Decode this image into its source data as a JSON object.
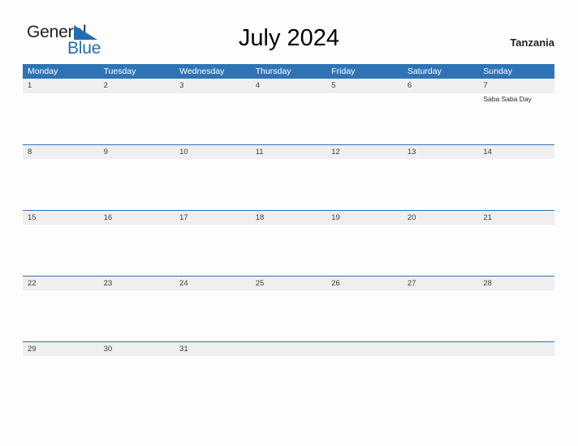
{
  "brand": {
    "name_part1": "General",
    "name_part2": "Blue",
    "flag_icon": "blue-triangle-flag-icon",
    "color_dark": "#231f20",
    "color_blue": "#1f6eb3"
  },
  "header": {
    "title": "July 2024",
    "country": "Tanzania"
  },
  "theme": {
    "accent": "#2e74b5",
    "date_band": "#efefef",
    "page_background": "#fdfdfd",
    "header_text": "#ffffff"
  },
  "calendar": {
    "month": "July",
    "year": "2024",
    "week_start": "Monday",
    "weekdays": [
      "Monday",
      "Tuesday",
      "Wednesday",
      "Thursday",
      "Friday",
      "Saturday",
      "Sunday"
    ],
    "weeks": [
      {
        "days": [
          {
            "date": "1",
            "events": []
          },
          {
            "date": "2",
            "events": []
          },
          {
            "date": "3",
            "events": []
          },
          {
            "date": "4",
            "events": []
          },
          {
            "date": "5",
            "events": []
          },
          {
            "date": "6",
            "events": []
          },
          {
            "date": "7",
            "events": [
              "Saba Saba Day"
            ]
          }
        ]
      },
      {
        "days": [
          {
            "date": "8",
            "events": []
          },
          {
            "date": "9",
            "events": []
          },
          {
            "date": "10",
            "events": []
          },
          {
            "date": "11",
            "events": []
          },
          {
            "date": "12",
            "events": []
          },
          {
            "date": "13",
            "events": []
          },
          {
            "date": "14",
            "events": []
          }
        ]
      },
      {
        "days": [
          {
            "date": "15",
            "events": []
          },
          {
            "date": "16",
            "events": []
          },
          {
            "date": "17",
            "events": []
          },
          {
            "date": "18",
            "events": []
          },
          {
            "date": "19",
            "events": []
          },
          {
            "date": "20",
            "events": []
          },
          {
            "date": "21",
            "events": []
          }
        ]
      },
      {
        "days": [
          {
            "date": "22",
            "events": []
          },
          {
            "date": "23",
            "events": []
          },
          {
            "date": "24",
            "events": []
          },
          {
            "date": "25",
            "events": []
          },
          {
            "date": "26",
            "events": []
          },
          {
            "date": "27",
            "events": []
          },
          {
            "date": "28",
            "events": []
          }
        ]
      },
      {
        "days": [
          {
            "date": "29",
            "events": []
          },
          {
            "date": "30",
            "events": []
          },
          {
            "date": "31",
            "events": []
          },
          {
            "date": "",
            "events": []
          },
          {
            "date": "",
            "events": []
          },
          {
            "date": "",
            "events": []
          },
          {
            "date": "",
            "events": []
          }
        ]
      }
    ]
  }
}
